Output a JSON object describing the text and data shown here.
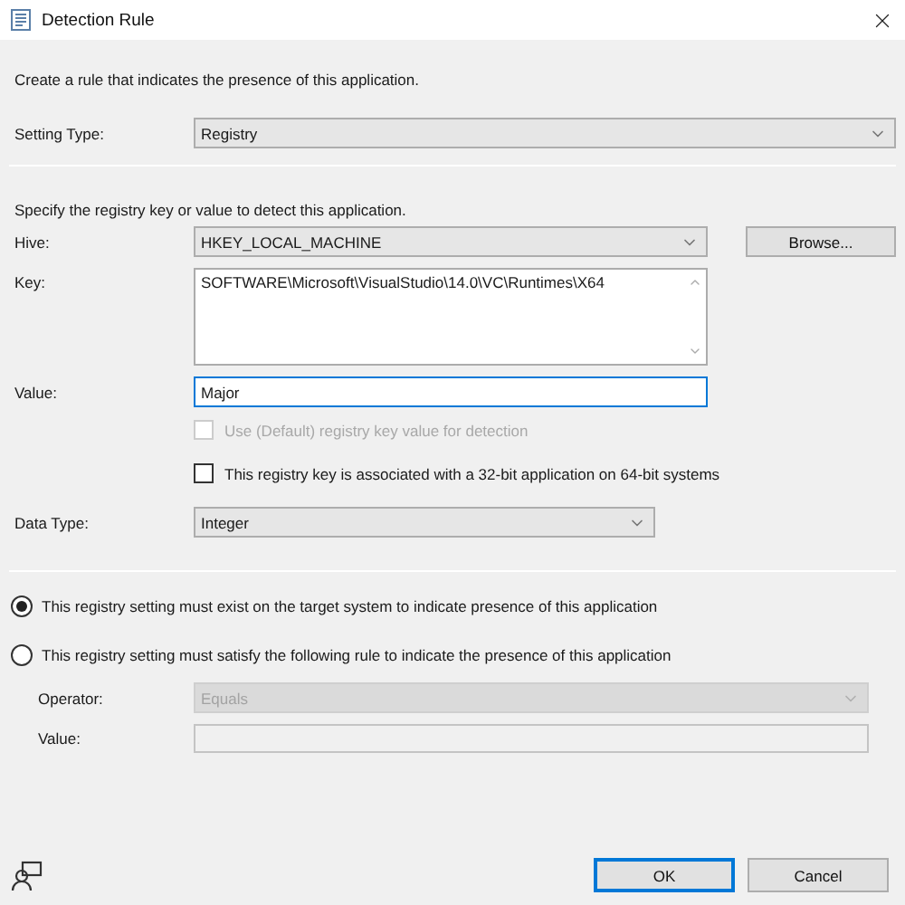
{
  "window": {
    "title": "Detection Rule"
  },
  "intro": "Create a rule that indicates the presence of this application.",
  "setting_type": {
    "label": "Setting Type:",
    "value": "Registry"
  },
  "registry_intro": "Specify the registry key or value to detect this application.",
  "hive": {
    "label": "Hive:",
    "value": "HKEY_LOCAL_MACHINE"
  },
  "browse_button": "Browse...",
  "key": {
    "label": "Key:",
    "value": "SOFTWARE\\Microsoft\\VisualStudio\\14.0\\VC\\Runtimes\\X64"
  },
  "value": {
    "label": "Value:",
    "value": "Major",
    "focused": true
  },
  "checkboxes": [
    {
      "label": "Use (Default) registry key value for detection",
      "checked": false,
      "disabled": true
    },
    {
      "label": "This registry key is associated with a 32-bit application on 64-bit systems",
      "checked": false,
      "disabled": false
    }
  ],
  "data_type": {
    "label": "Data Type:",
    "value": "Integer"
  },
  "rules": [
    {
      "label": "This registry setting must exist on the target system to indicate presence of this application",
      "selected": true
    },
    {
      "label": "This registry setting must satisfy the following rule to indicate the presence of this application",
      "selected": false
    }
  ],
  "operator": {
    "label": "Operator:",
    "value": "Equals",
    "disabled": true
  },
  "rule_value": {
    "label": "Value:",
    "disabled": true
  },
  "buttons": [
    {
      "label": "OK",
      "default": true
    },
    {
      "label": "Cancel",
      "default": false
    }
  ]
}
